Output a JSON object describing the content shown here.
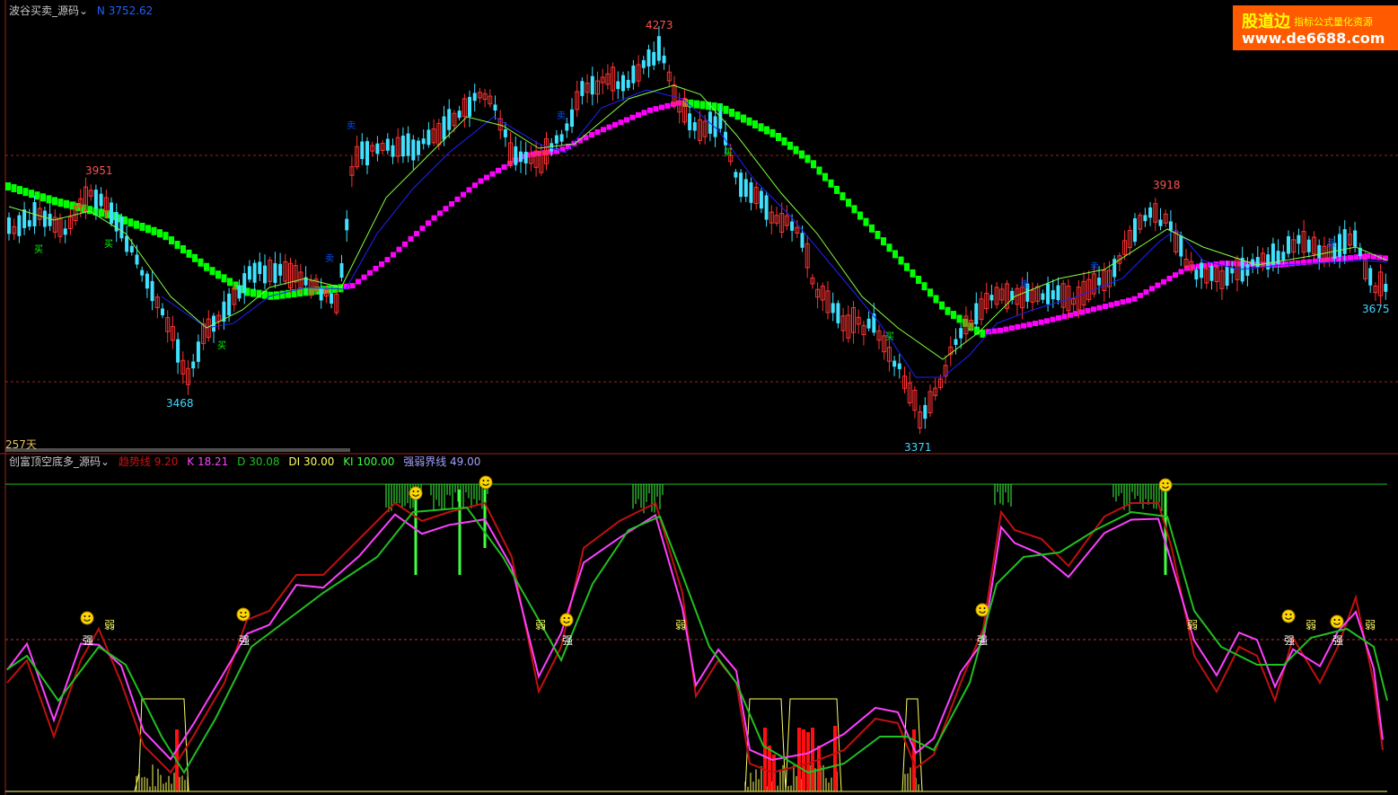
{
  "main_panel": {
    "indicator_name": "波谷买卖_源码",
    "value_label": "N 3752.62",
    "days_label": "257天",
    "peak_labels": [
      {
        "text": "3951",
        "color": "#ff5050"
      },
      {
        "text": "4273",
        "color": "#ff5050"
      },
      {
        "text": "3918",
        "color": "#ff5050"
      },
      {
        "text": "3468",
        "color": "#40d8ff"
      },
      {
        "text": "3371",
        "color": "#40d8ff"
      },
      {
        "text": "3675",
        "color": "#40d8ff"
      }
    ],
    "markers": [
      {
        "glyph": "卖",
        "color": "#0050ff"
      },
      {
        "glyph": "买",
        "color": "#00ff00"
      }
    ]
  },
  "sub_panel": {
    "indicator_name": "创富顶空底多_源码",
    "legend": [
      {
        "text": "趋势线 9.20",
        "color": "#d01010"
      },
      {
        "text": "K 18.21",
        "color": "#ff40ff"
      },
      {
        "text": "D 30.08",
        "color": "#20c020"
      },
      {
        "text": "DI 30.00",
        "color": "#ffff60"
      },
      {
        "text": "KI 100.00",
        "color": "#40ff40"
      },
      {
        "text": "强弱界线 49.00",
        "color": "#a0a0ff"
      }
    ],
    "strong_label": "强",
    "weak_label": "弱"
  },
  "logo": {
    "line1": "股道边",
    "line2": "指标公式量化资源",
    "line3": "www.de6688.com"
  },
  "colors": {
    "up_candle": "#ff3232",
    "down_candle": "#40e0ff",
    "ribbon_up": "#00ff00",
    "ribbon_down": "#ff00ff",
    "ma_fast": "#2020ff",
    "ma_slow": "#80ff40"
  }
}
